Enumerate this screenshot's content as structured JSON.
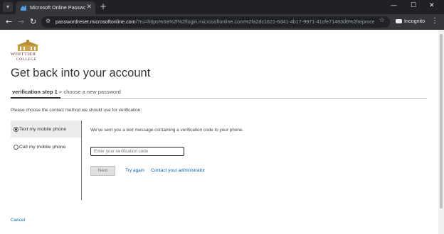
{
  "browser": {
    "tab_title": "Microsoft Online Password Rese",
    "new_tab_symbol": "+",
    "url_host": "passwordreset.microsoftonline.com",
    "url_rest": "/?ru=https%3a%2f%2flogin.microsoftonline.com%2fa2dc1621-6d41-4b17-9971-41cfe71483d6%2freprocess%...",
    "profile_label": "Incognito"
  },
  "org_logo": {
    "line1": "WHITTIER",
    "line2": "COLLEGE"
  },
  "page": {
    "title": "Get back into your account",
    "step_active": "verification step 1",
    "step_separator": ">",
    "step_next": "choose a new password",
    "instructions": "Please choose the contact method we should use for verification:"
  },
  "methods": [
    {
      "label": "Text my mobile phone",
      "selected": true
    },
    {
      "label": "Call my mobile phone",
      "selected": false
    }
  ],
  "verification": {
    "sent_message": "We've sent you a text message containing a verification code to your phone.",
    "code_placeholder": "Enter your verification code",
    "code_value": "",
    "next_label": "Next",
    "try_again_label": "Try again",
    "contact_admin_label": "Contact your administrator"
  },
  "cancel_label": "Cancel",
  "colors": {
    "link": "#0067b8",
    "logo": "#6b2c2c",
    "chrome_dark": "#202124",
    "chrome_toolbar": "#35363a"
  }
}
